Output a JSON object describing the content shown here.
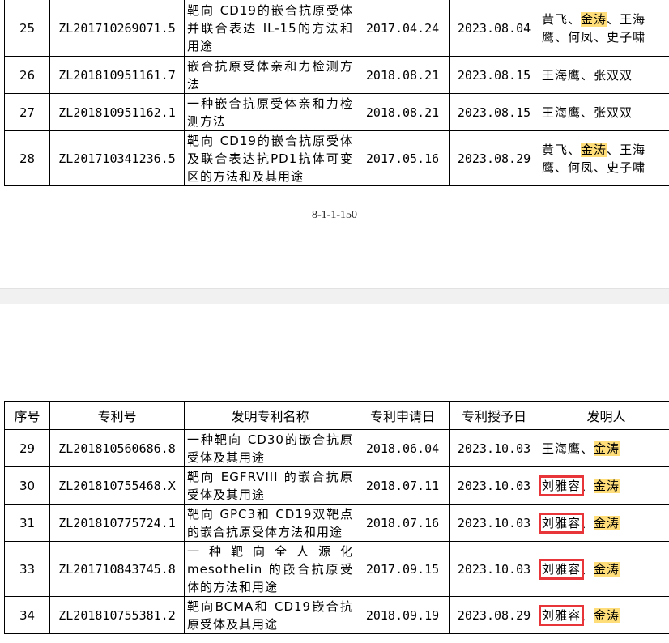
{
  "page1": {
    "page_number": "8-1-1-150",
    "rows": [
      {
        "seq": "25",
        "patent_no": "ZL201710269071.5",
        "title": "靶向 CD19的嵌合抗原受体并联合表达 IL-15的方法和用途",
        "filed": "2017.04.24",
        "granted": "2023.08.04",
        "inventors": [
          {
            "name": "黄飞",
            "hl": false
          },
          {
            "name": "金涛",
            "hl": true
          },
          {
            "name": "王海鹰",
            "hl": false
          },
          {
            "name": "何凤",
            "hl": false
          },
          {
            "name": "史子啸",
            "hl": false
          }
        ]
      },
      {
        "seq": "26",
        "patent_no": "ZL201810951161.7",
        "title": "嵌合抗原受体亲和力检测方法",
        "filed": "2018.08.21",
        "granted": "2023.08.15",
        "inventors": [
          {
            "name": "王海鹰",
            "hl": false
          },
          {
            "name": "张双双",
            "hl": false
          }
        ]
      },
      {
        "seq": "27",
        "patent_no": "ZL201810951162.1",
        "title": "一种嵌合抗原受体亲和力检测方法",
        "filed": "2018.08.21",
        "granted": "2023.08.15",
        "inventors": [
          {
            "name": "王海鹰",
            "hl": false
          },
          {
            "name": "张双双",
            "hl": false
          }
        ]
      },
      {
        "seq": "28",
        "patent_no": "ZL201710341236.5",
        "title": "靶向 CD19的嵌合抗原受体及联合表达抗PD1抗体可变区的方法和及其用途",
        "filed": "2017.05.16",
        "granted": "2023.08.29",
        "inventors": [
          {
            "name": "黄飞",
            "hl": false
          },
          {
            "name": "金涛",
            "hl": true
          },
          {
            "name": "王海鹰",
            "hl": false
          },
          {
            "name": "何凤",
            "hl": false
          },
          {
            "name": "史子啸",
            "hl": false
          }
        ]
      }
    ]
  },
  "page2": {
    "headers": {
      "seq": "序号",
      "patent_no": "专利号",
      "title": "发明专利名称",
      "filed": "专利申请日",
      "granted": "专利授予日",
      "inventors": "发明人"
    },
    "rows": [
      {
        "seq": "29",
        "patent_no": "ZL201810560686.8",
        "title": "一种靶向 CD30的嵌合抗原受体及其用途",
        "filed": "2018.06.04",
        "granted": "2023.10.03",
        "inventors": [
          {
            "name": "王海鹰",
            "hl": false,
            "boxed": false
          },
          {
            "name": "金涛",
            "hl": true,
            "boxed": false
          }
        ]
      },
      {
        "seq": "30",
        "patent_no": "ZL201810755468.X",
        "title": "靶向 EGFRVIII 的嵌合抗原受体及其用途",
        "filed": "2018.07.11",
        "granted": "2023.10.03",
        "inventors": [
          {
            "name": "刘雅容",
            "hl": false,
            "boxed": true
          },
          {
            "name": "金涛",
            "hl": true,
            "boxed": false
          }
        ]
      },
      {
        "seq": "31",
        "patent_no": "ZL201810775724.1",
        "title": "靶向 GPC3和 CD19双靶点的嵌合抗原受体方法和用途",
        "filed": "2018.07.16",
        "granted": "2023.10.03",
        "inventors": [
          {
            "name": "刘雅容",
            "hl": false,
            "boxed": true
          },
          {
            "name": "金涛",
            "hl": true,
            "boxed": false
          }
        ]
      },
      {
        "seq": "33",
        "patent_no": "ZL201710843745.8",
        "title": "一种靶向全人源化 mesothelin 的嵌合抗原受体的方法和用途",
        "filed": "2017.09.15",
        "granted": "2023.10.03",
        "inventors": [
          {
            "name": "刘雅容",
            "hl": false,
            "boxed": true
          },
          {
            "name": "金涛",
            "hl": true,
            "boxed": false
          }
        ]
      },
      {
        "seq": "34",
        "patent_no": "ZL201810755381.2",
        "title": "靶向BCMA和 CD19嵌合抗原受体及其用途",
        "filed": "2018.09.19",
        "granted": "2023.08.29",
        "inventors": [
          {
            "name": "刘雅容",
            "hl": false,
            "boxed": true
          },
          {
            "name": "金涛",
            "hl": true,
            "boxed": false
          }
        ]
      }
    ]
  },
  "style": {
    "highlight_color": "#ffde7a",
    "box_color": "#e8353a",
    "separator": "、"
  }
}
